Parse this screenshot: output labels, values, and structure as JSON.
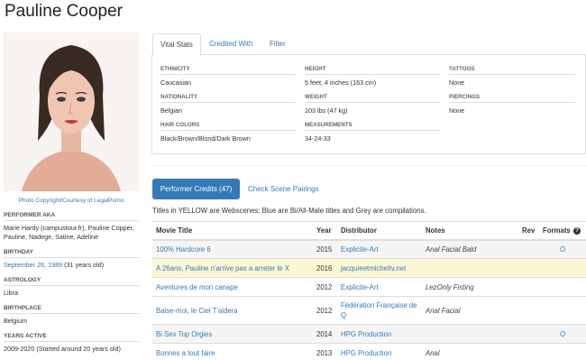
{
  "performer": {
    "name": "Pauline Cooper",
    "photo_credit": "Photo Copyright/Courtesy of LegalPorno"
  },
  "sidebar": {
    "aka_label": "PERFORMER AKA",
    "aka_value": "Marie Hardy (campustour.fr), Pauline Copper, Pauline, Nadege, Satine, Adeline",
    "birthday_label": "BIRTHDAY",
    "birthday_date": "September 26, 1989",
    "birthday_age": "(31 years old)",
    "astrology_label": "ASTROLOGY",
    "astrology_value": "Libra",
    "birthplace_label": "BIRTHPLACE",
    "birthplace_value": "Belgium",
    "years_label": "YEARS ACTIVE",
    "years_value": "2009-2020 (Started around 20 years old)"
  },
  "tabs": [
    "Vital Stats",
    "Credited With",
    "Filter"
  ],
  "stats": {
    "ethnicity_label": "ETHNICITY",
    "ethnicity": "Caucasian",
    "nationality_label": "NATIONALITY",
    "nationality": "Belgian",
    "hair_label": "HAIR COLORS",
    "hair": "Black/Brown/Blond/Dark Brown",
    "height_label": "HEIGHT",
    "height": "5 feet, 4 inches (163 cm)",
    "weight_label": "WEIGHT",
    "weight": "103 lbs (47 kg)",
    "measurements_label": "MEASUREMENTS",
    "measurements": "34-24-33",
    "tattoos_label": "TATTOOS",
    "tattoos": "None",
    "piercings_label": "PIERCINGS",
    "piercings": "None"
  },
  "credits": {
    "button_label": "Performer Credits (47)",
    "pairings_label": "Check Scene Pairings",
    "legend": "Titles in YELLOW are Webscenes; Blue are Bi/All-Male titles and Grey are compilations.",
    "columns": [
      "Movie Title",
      "Year",
      "Distributor",
      "Notes",
      "Rev",
      "Formats"
    ],
    "help_icon": "question-circle-icon",
    "rows": [
      {
        "title": "100% Hardcore 6",
        "year": "2015",
        "distributor": "Explicite-Art",
        "notes": "Anal Facial Bald",
        "rev": "",
        "formats": "O",
        "style": "grey"
      },
      {
        "title": "A 26ans, Pauline n'arrive pas a arreter le X",
        "year": "2016",
        "distributor": "jacquieetmicheltv.net",
        "notes": "",
        "rev": "",
        "formats": "",
        "style": "yellow"
      },
      {
        "title": "Aventures de mon canape",
        "year": "2012",
        "distributor": "Explicite-Art",
        "notes": "LezOnly Fisting",
        "rev": "",
        "formats": "",
        "style": "white"
      },
      {
        "title": "Baise-moi, le Ciel T'aidera",
        "year": "2012",
        "distributor": "Fédération Française de Q",
        "notes": "Anal Facial",
        "rev": "",
        "formats": "",
        "style": "white"
      },
      {
        "title": "Bi Sex Top Orgies",
        "year": "2014",
        "distributor": "HPG Production",
        "notes": "",
        "rev": "",
        "formats": "O",
        "style": "grey"
      },
      {
        "title": "Bonnes a tout faire",
        "year": "2013",
        "distributor": "HPG Production",
        "notes": "Anal",
        "rev": "",
        "formats": "",
        "style": "white"
      }
    ]
  }
}
